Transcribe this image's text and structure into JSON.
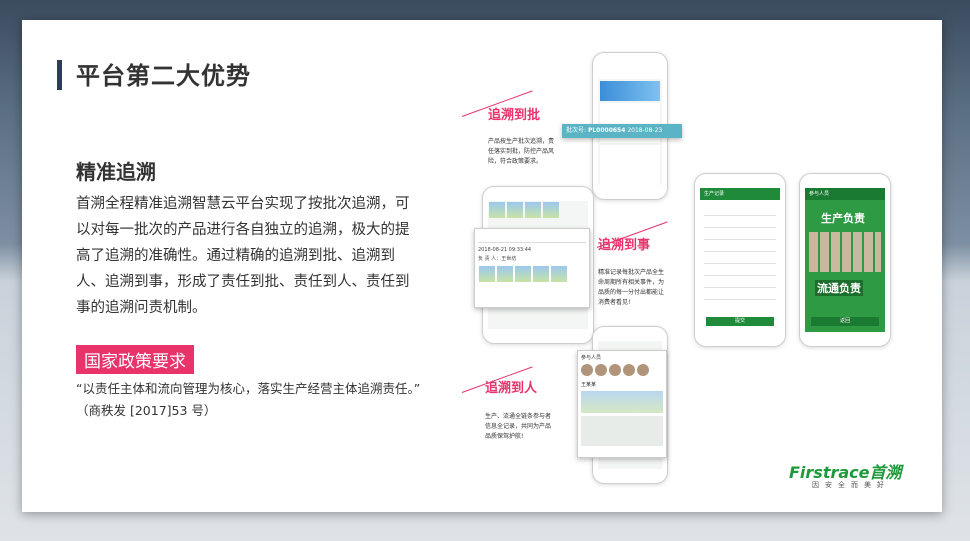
{
  "slide": {
    "title": "平台第二大优势",
    "subtitle": "精准追溯",
    "paragraph": "首溯全程精准追溯智慧云平台实现了按批次追溯，可以对每一批次的产品进行各自独立的追溯，极大的提高了追溯的准确性。通过精确的追溯到批、追溯到人、追溯到事，形成了责任到批、责任到人、责任到事的追溯问责机制。",
    "policy_label": "国家政策要求",
    "quote": "“以责任主体和流向管理为核心，落实生产经营主体追溯责任。” （商秩发 [2017]53 号）"
  },
  "sections": [
    {
      "title": "追溯到批",
      "text": "产品按生产批次追溯，责任落实到批，防控产品风险，符合政策要求。"
    },
    {
      "title": "追溯到事",
      "text": "精准记录每批次产品全生命周期所有相关事件，为品质的每一分付出都能让消费者看见!"
    },
    {
      "title": "追溯到人",
      "text": "生产、流通全链条参与者信息全记录，共同为产品品质保驾护航!"
    }
  ],
  "batch_banner": {
    "label": "批次号:",
    "code": "PL0000654",
    "date": "2018-08-23"
  },
  "record_card": {
    "date_label": "2018-08-21 09:33:44",
    "person_label": "负 责 人：",
    "person": "王世坊"
  },
  "people_card": {
    "header": "参与人员",
    "name": "王某某"
  },
  "phone_green_a": {
    "header": "生产记录",
    "button": "提交"
  },
  "phone_green_b": {
    "header": "参与人员",
    "banner_top": "生产负责",
    "banner_bottom": "流通负责",
    "button": "返回"
  },
  "brand": {
    "logo": "Firstrace首溯",
    "slogan": "因安全而美好"
  },
  "colors": {
    "accent": "#e8336b",
    "green": "#1f8a3a",
    "title_bar": "#2f3c55"
  }
}
